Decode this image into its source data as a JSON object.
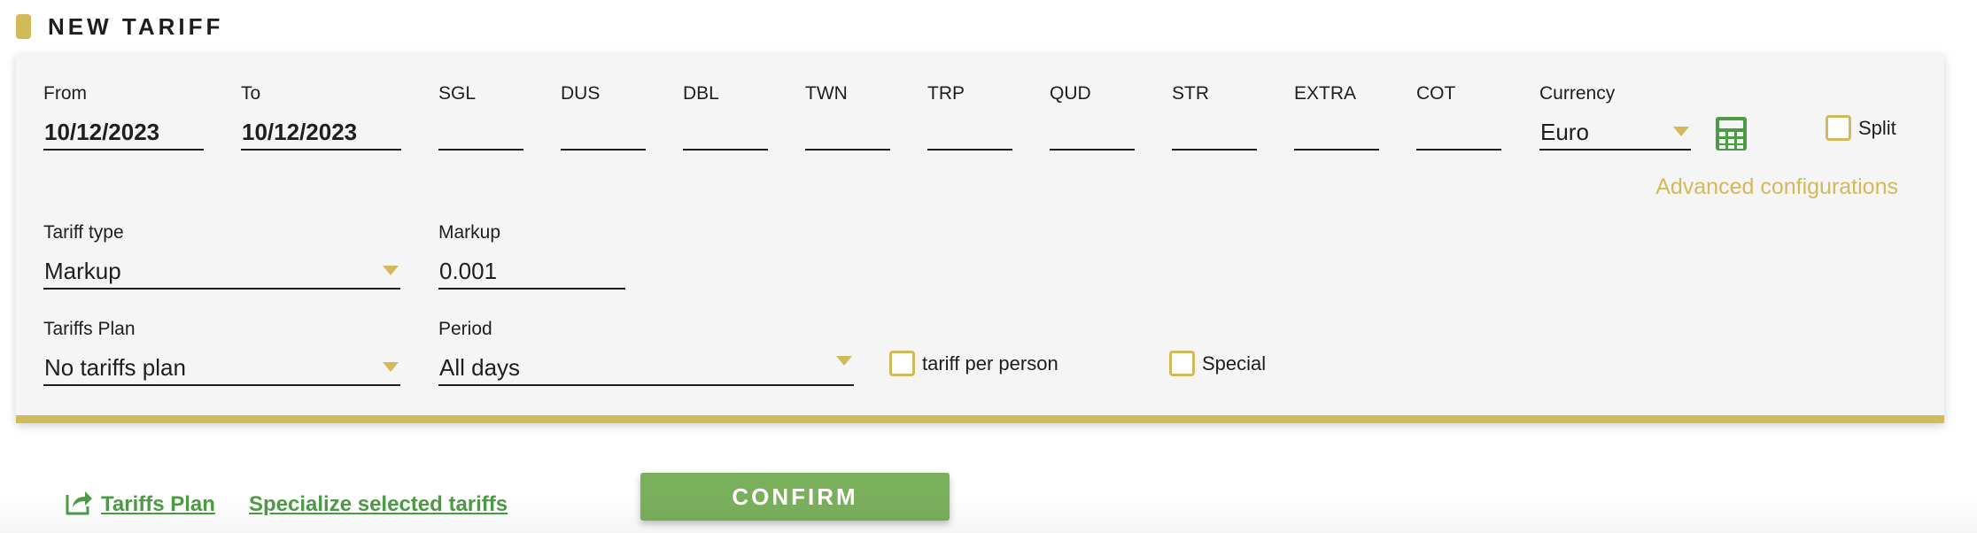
{
  "header": {
    "title": "NEW TARIFF"
  },
  "row1": {
    "from": {
      "label": "From",
      "value": "10/12/2023"
    },
    "to": {
      "label": "To",
      "value": "10/12/2023"
    },
    "sgl": {
      "label": "SGL",
      "value": ""
    },
    "dus": {
      "label": "DUS",
      "value": ""
    },
    "dbl": {
      "label": "DBL",
      "value": ""
    },
    "twn": {
      "label": "TWN",
      "value": ""
    },
    "trp": {
      "label": "TRP",
      "value": ""
    },
    "qud": {
      "label": "QUD",
      "value": ""
    },
    "str": {
      "label": "STR",
      "value": ""
    },
    "extra": {
      "label": "EXTRA",
      "value": ""
    },
    "cot": {
      "label": "COT",
      "value": ""
    },
    "currency": {
      "label": "Currency",
      "value": "Euro"
    },
    "split": {
      "label": "Split",
      "checked": false
    }
  },
  "advanced_link": "Advanced configurations",
  "row2": {
    "tariff_type": {
      "label": "Tariff type",
      "value": "Markup"
    },
    "markup": {
      "label": "Markup",
      "value": "0.001"
    }
  },
  "row3": {
    "tariffs_plan": {
      "label": "Tariffs Plan",
      "value": "No tariffs plan"
    },
    "period": {
      "label": "Period",
      "value": "All days"
    },
    "tariff_per_person": {
      "label": "tariff per person",
      "checked": false
    },
    "special": {
      "label": "Special",
      "checked": false
    }
  },
  "actions": {
    "tariffs_plan_link": "Tariffs Plan",
    "specialize_link": "Specialize selected tariffs",
    "confirm": "CONFIRM"
  },
  "colors": {
    "accent": "#d2b95a",
    "green": "#4e9a46",
    "confirm_bg": "#7aaf5c",
    "panel_bg": "#f5f5f5"
  }
}
